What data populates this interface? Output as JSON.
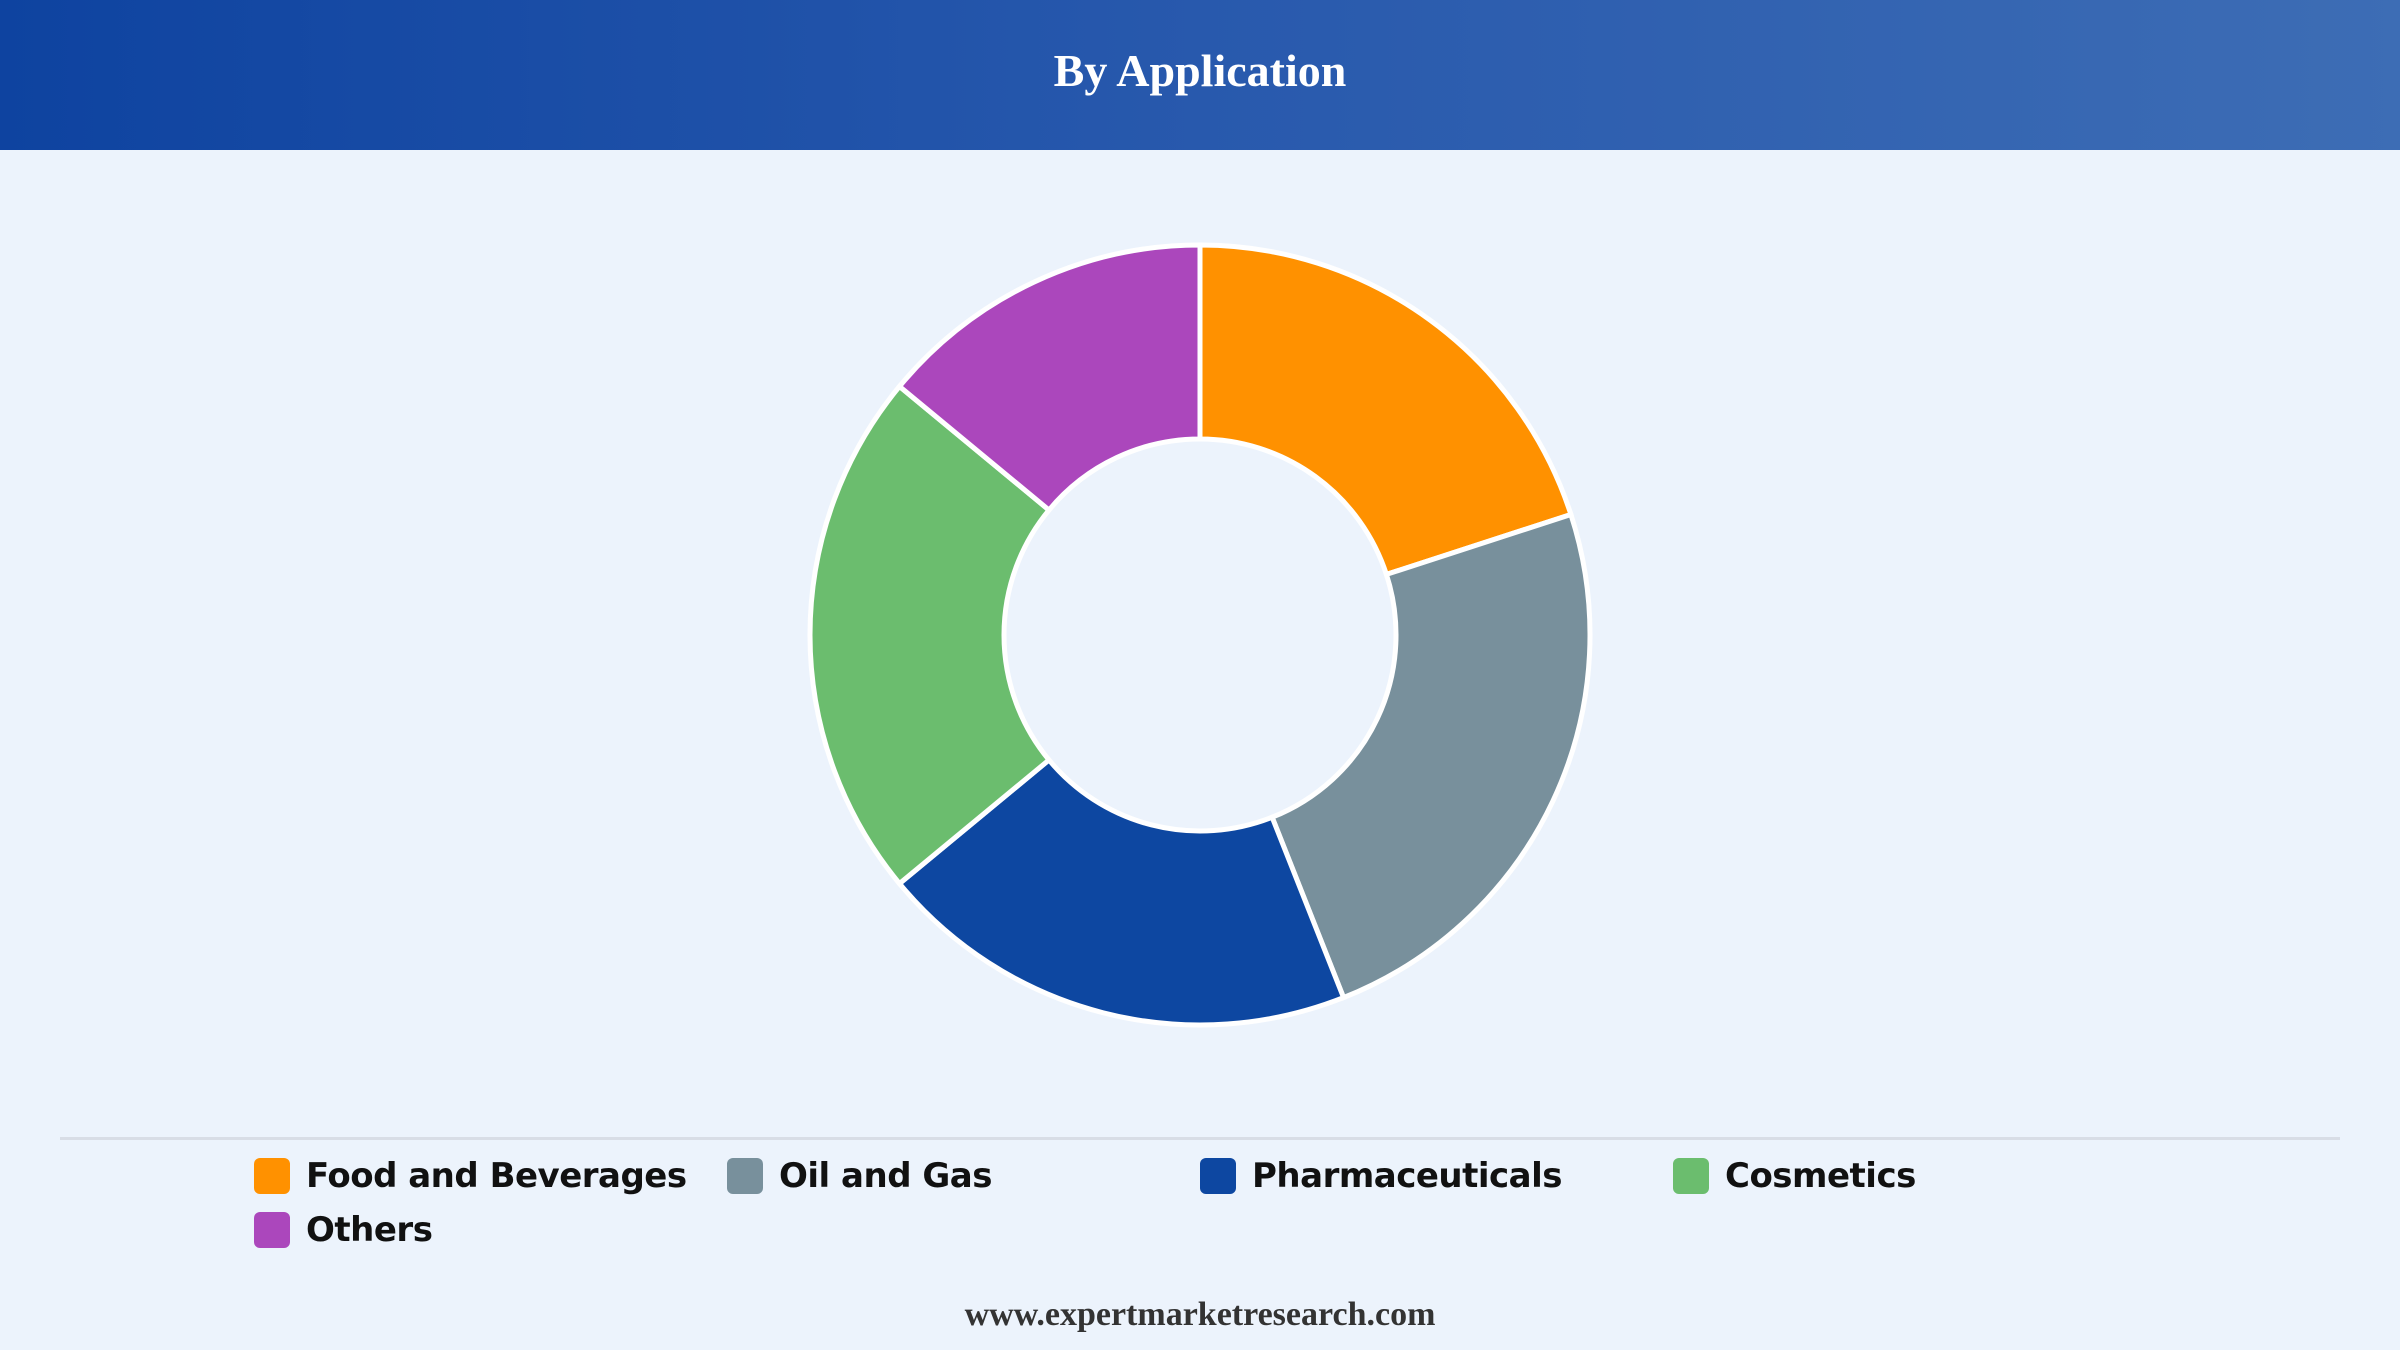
{
  "header": {
    "title": "By Application"
  },
  "chart_data": {
    "type": "pie",
    "variant": "donut",
    "title": "By Application",
    "categories": [
      "Food and Beverages",
      "Oil and Gas",
      "Pharmaceuticals",
      "Cosmetics",
      "Others"
    ],
    "values": [
      20,
      24,
      20,
      22,
      14
    ],
    "unit": "%",
    "colors": [
      "#ff9100",
      "#78909c",
      "#0d47a1",
      "#6bbd6e",
      "#ab47bc"
    ],
    "legend_position": "bottom"
  },
  "footer": {
    "source": "www.expertmarketresearch.com"
  }
}
